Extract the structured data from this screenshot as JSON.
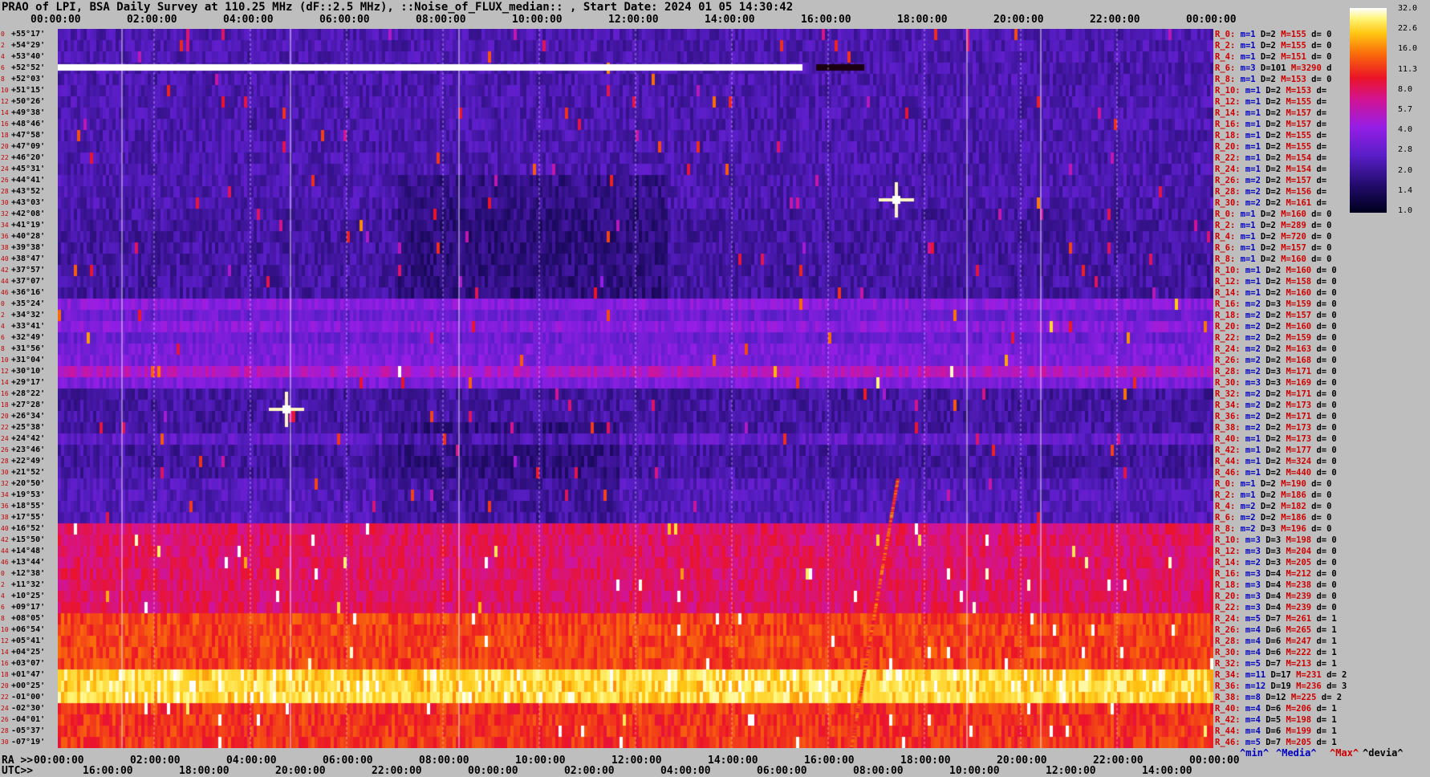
{
  "title": "PRAO of LPI, BSA Daily Survey at 110.25 MHz (dF::2.5 MHz), ::Noise_of_FLUX_median:: , Start Date: 2024 01 05 14:30:42",
  "top_ticks": [
    "00:00:00",
    "02:00:00",
    "04:00:00",
    "06:00:00",
    "08:00:00",
    "10:00:00",
    "12:00:00",
    "14:00:00",
    "16:00:00",
    "18:00:00",
    "20:00:00",
    "22:00:00",
    "00:00:00"
  ],
  "bottom_ra_label": "RA >>",
  "bottom_ra_ticks": [
    "00:00:00",
    "02:00:00",
    "04:00:00",
    "06:00:00",
    "08:00:00",
    "10:00:00",
    "12:00:00",
    "14:00:00",
    "16:00:00",
    "18:00:00",
    "20:00:00",
    "22:00:00",
    "00:00:00"
  ],
  "bottom_utc_label": "UTC>>",
  "bottom_utc_ticks": [
    "16:00:00",
    "18:00:00",
    "20:00:00",
    "22:00:00",
    "00:00:00",
    "02:00:00",
    "04:00:00",
    "06:00:00",
    "08:00:00",
    "10:00:00",
    "12:00:00",
    "14:00:00"
  ],
  "declinations": [
    "+55°17'",
    "+54°29'",
    "+53°40'",
    "+52°52'",
    "+52°03'",
    "+51°15'",
    "+50°26'",
    "+49°38'",
    "+48°46'",
    "+47°58'",
    "+47°09'",
    "+46°20'",
    "+45°31'",
    "+44°41'",
    "+43°52'",
    "+43°03'",
    "+42°08'",
    "+41°19'",
    "+40°28'",
    "+39°38'",
    "+38°47'",
    "+37°57'",
    "+37°07'",
    "+36°16'",
    "+35°24'",
    "+34°32'",
    "+33°41'",
    "+32°49'",
    "+31°56'",
    "+31°04'",
    "+30°10'",
    "+29°17'",
    "+28°22'",
    "+27°28'",
    "+26°34'",
    "+25°38'",
    "+24°42'",
    "+23°46'",
    "+22°49'",
    "+21°52'",
    "+20°50'",
    "+19°53'",
    "+18°55'",
    "+17°55'",
    "+16°52'",
    "+15°50'",
    "+14°48'",
    "+13°44'",
    "+12°38'",
    "+11°32'",
    "+10°25'",
    "+09°17'",
    "+08°05'",
    "+06°54'",
    "+05°41'",
    "+04°25'",
    "+03°07'",
    "+01°47'",
    "+00°25'",
    "-01°00'",
    "-02°30'",
    "-04°01'",
    "-05°37'",
    "-07°19'"
  ],
  "stats": [
    {
      "r": "R_0:",
      "m": "m=1",
      "d": "D=2",
      "x": "M=155",
      "dv": "d= 0"
    },
    {
      "r": "R_2:",
      "m": "m=1",
      "d": "D=2",
      "x": "M=155",
      "dv": "d= 0"
    },
    {
      "r": "R_4:",
      "m": "m=1",
      "d": "D=2",
      "x": "M=151",
      "dv": "d= 0"
    },
    {
      "r": "R_6:",
      "m": "m=3",
      "d": "D=101",
      "x": "M=3290",
      "dv": "d"
    },
    {
      "r": "R_8:",
      "m": "m=1",
      "d": "D=2",
      "x": "M=153",
      "dv": "d= 0"
    },
    {
      "r": "R_10:",
      "m": "m=1",
      "d": "D=2",
      "x": "M=153",
      "dv": "d="
    },
    {
      "r": "R_12:",
      "m": "m=1",
      "d": "D=2",
      "x": "M=155",
      "dv": "d="
    },
    {
      "r": "R_14:",
      "m": "m=1",
      "d": "D=2",
      "x": "M=157",
      "dv": "d="
    },
    {
      "r": "R_16:",
      "m": "m=1",
      "d": "D=2",
      "x": "M=157",
      "dv": "d="
    },
    {
      "r": "R_18:",
      "m": "m=1",
      "d": "D=2",
      "x": "M=155",
      "dv": "d="
    },
    {
      "r": "R_20:",
      "m": "m=1",
      "d": "D=2",
      "x": "M=155",
      "dv": "d="
    },
    {
      "r": "R_22:",
      "m": "m=1",
      "d": "D=2",
      "x": "M=154",
      "dv": "d="
    },
    {
      "r": "R_24:",
      "m": "m=1",
      "d": "D=2",
      "x": "M=154",
      "dv": "d="
    },
    {
      "r": "R_26:",
      "m": "m=2",
      "d": "D=2",
      "x": "M=157",
      "dv": "d="
    },
    {
      "r": "R_28:",
      "m": "m=2",
      "d": "D=2",
      "x": "M=156",
      "dv": "d="
    },
    {
      "r": "R_30:",
      "m": "m=2",
      "d": "D=2",
      "x": "M=161",
      "dv": "d="
    },
    {
      "r": "R_0:",
      "m": "m=1",
      "d": "D=2",
      "x": "M=160",
      "dv": "d= 0"
    },
    {
      "r": "R_2:",
      "m": "m=1",
      "d": "D=2",
      "x": "M=289",
      "dv": "d= 0"
    },
    {
      "r": "R_4:",
      "m": "m=1",
      "d": "D=2",
      "x": "M=720",
      "dv": "d= 0"
    },
    {
      "r": "R_6:",
      "m": "m=1",
      "d": "D=2",
      "x": "M=157",
      "dv": "d= 0"
    },
    {
      "r": "R_8:",
      "m": "m=1",
      "d": "D=2",
      "x": "M=160",
      "dv": "d= 0"
    },
    {
      "r": "R_10:",
      "m": "m=1",
      "d": "D=2",
      "x": "M=160",
      "dv": "d= 0"
    },
    {
      "r": "R_12:",
      "m": "m=1",
      "d": "D=2",
      "x": "M=158",
      "dv": "d= 0"
    },
    {
      "r": "R_14:",
      "m": "m=1",
      "d": "D=2",
      "x": "M=160",
      "dv": "d= 0"
    },
    {
      "r": "R_16:",
      "m": "m=2",
      "d": "D=3",
      "x": "M=159",
      "dv": "d= 0"
    },
    {
      "r": "R_18:",
      "m": "m=2",
      "d": "D=2",
      "x": "M=157",
      "dv": "d= 0"
    },
    {
      "r": "R_20:",
      "m": "m=2",
      "d": "D=2",
      "x": "M=160",
      "dv": "d= 0"
    },
    {
      "r": "R_22:",
      "m": "m=2",
      "d": "D=2",
      "x": "M=159",
      "dv": "d= 0"
    },
    {
      "r": "R_24:",
      "m": "m=2",
      "d": "D=2",
      "x": "M=163",
      "dv": "d= 0"
    },
    {
      "r": "R_26:",
      "m": "m=2",
      "d": "D=2",
      "x": "M=168",
      "dv": "d= 0"
    },
    {
      "r": "R_28:",
      "m": "m=2",
      "d": "D=3",
      "x": "M=171",
      "dv": "d= 0"
    },
    {
      "r": "R_30:",
      "m": "m=3",
      "d": "D=3",
      "x": "M=169",
      "dv": "d= 0"
    },
    {
      "r": "R_32:",
      "m": "m=2",
      "d": "D=2",
      "x": "M=171",
      "dv": "d= 0"
    },
    {
      "r": "R_34:",
      "m": "m=2",
      "d": "D=2",
      "x": "M=173",
      "dv": "d= 0"
    },
    {
      "r": "R_36:",
      "m": "m=2",
      "d": "D=2",
      "x": "M=171",
      "dv": "d= 0"
    },
    {
      "r": "R_38:",
      "m": "m=2",
      "d": "D=2",
      "x": "M=173",
      "dv": "d= 0"
    },
    {
      "r": "R_40:",
      "m": "m=1",
      "d": "D=2",
      "x": "M=173",
      "dv": "d= 0"
    },
    {
      "r": "R_42:",
      "m": "m=1",
      "d": "D=2",
      "x": "M=177",
      "dv": "d= 0"
    },
    {
      "r": "R_44:",
      "m": "m=1",
      "d": "D=2",
      "x": "M=324",
      "dv": "d= 0"
    },
    {
      "r": "R_46:",
      "m": "m=1",
      "d": "D=2",
      "x": "M=440",
      "dv": "d= 0"
    },
    {
      "r": "R_0:",
      "m": "m=1",
      "d": "D=2",
      "x": "M=190",
      "dv": "d= 0"
    },
    {
      "r": "R_2:",
      "m": "m=1",
      "d": "D=2",
      "x": "M=186",
      "dv": "d= 0"
    },
    {
      "r": "R_4:",
      "m": "m=2",
      "d": "D=2",
      "x": "M=182",
      "dv": "d= 0"
    },
    {
      "r": "R_6:",
      "m": "m=2",
      "d": "D=2",
      "x": "M=186",
      "dv": "d= 0"
    },
    {
      "r": "R_8:",
      "m": "m=2",
      "d": "D=3",
      "x": "M=196",
      "dv": "d= 0"
    },
    {
      "r": "R_10:",
      "m": "m=3",
      "d": "D=3",
      "x": "M=198",
      "dv": "d= 0"
    },
    {
      "r": "R_12:",
      "m": "m=3",
      "d": "D=3",
      "x": "M=204",
      "dv": "d= 0"
    },
    {
      "r": "R_14:",
      "m": "m=2",
      "d": "D=3",
      "x": "M=205",
      "dv": "d= 0"
    },
    {
      "r": "R_16:",
      "m": "m=3",
      "d": "D=4",
      "x": "M=212",
      "dv": "d= 0"
    },
    {
      "r": "R_18:",
      "m": "m=3",
      "d": "D=4",
      "x": "M=238",
      "dv": "d= 0"
    },
    {
      "r": "R_20:",
      "m": "m=3",
      "d": "D=4",
      "x": "M=239",
      "dv": "d= 0"
    },
    {
      "r": "R_22:",
      "m": "m=3",
      "d": "D=4",
      "x": "M=239",
      "dv": "d= 0"
    },
    {
      "r": "R_24:",
      "m": "m=5",
      "d": "D=7",
      "x": "M=261",
      "dv": "d= 1"
    },
    {
      "r": "R_26:",
      "m": "m=4",
      "d": "D=6",
      "x": "M=265",
      "dv": "d= 1"
    },
    {
      "r": "R_28:",
      "m": "m=4",
      "d": "D=6",
      "x": "M=247",
      "dv": "d= 1"
    },
    {
      "r": "R_30:",
      "m": "m=4",
      "d": "D=6",
      "x": "M=222",
      "dv": "d= 1"
    },
    {
      "r": "R_32:",
      "m": "m=5",
      "d": "D=7",
      "x": "M=213",
      "dv": "d= 1"
    },
    {
      "r": "R_34:",
      "m": "m=11",
      "d": "D=17",
      "x": "M=231",
      "dv": "d= 2"
    },
    {
      "r": "R_36:",
      "m": "m=12",
      "d": "D=19",
      "x": "M=236",
      "dv": "d= 3"
    },
    {
      "r": "R_38:",
      "m": "m=8",
      "d": "D=12",
      "x": "M=225",
      "dv": "d= 2"
    },
    {
      "r": "R_40:",
      "m": "m=4",
      "d": "D=6",
      "x": "M=206",
      "dv": "d= 1"
    },
    {
      "r": "R_42:",
      "m": "m=4",
      "d": "D=5",
      "x": "M=198",
      "dv": "d= 1"
    },
    {
      "r": "R_44:",
      "m": "m=4",
      "d": "D=6",
      "x": "M=199",
      "dv": "d= 1"
    },
    {
      "r": "R_46:",
      "m": "m=5",
      "d": "D=7",
      "x": "M=205",
      "dv": "d= 1"
    }
  ],
  "legend": {
    "min": "^min^",
    "median": "^Media^",
    "max": "^Max^",
    "devia": "^devia^"
  },
  "colors": {
    "min": "#0000c0",
    "median": "#0000c0",
    "max": "#d00000",
    "devia": "#000000",
    "accent": "#d00000"
  },
  "chart_data": {
    "type": "heatmap",
    "title": "PRAO of LPI, BSA Daily Survey at 110.25 MHz (dF::2.5 MHz), ::Noise_of_FLUX_median:: , Start Date: 2024 01 05 14:30:42",
    "x_axis": "RA 00:00:00 to 24:00:00 (top), UTC 14:30 to 14:30 next day (bottom)",
    "y_axis": "Declination rows +55°17' to -07°19'",
    "colorbar_ticks": [
      32.0,
      22.6,
      16.0,
      11.3,
      8.0,
      5.7,
      4.0,
      2.8,
      2.0,
      1.4,
      1.0
    ],
    "colorscale": "log",
    "rows": 64
  }
}
